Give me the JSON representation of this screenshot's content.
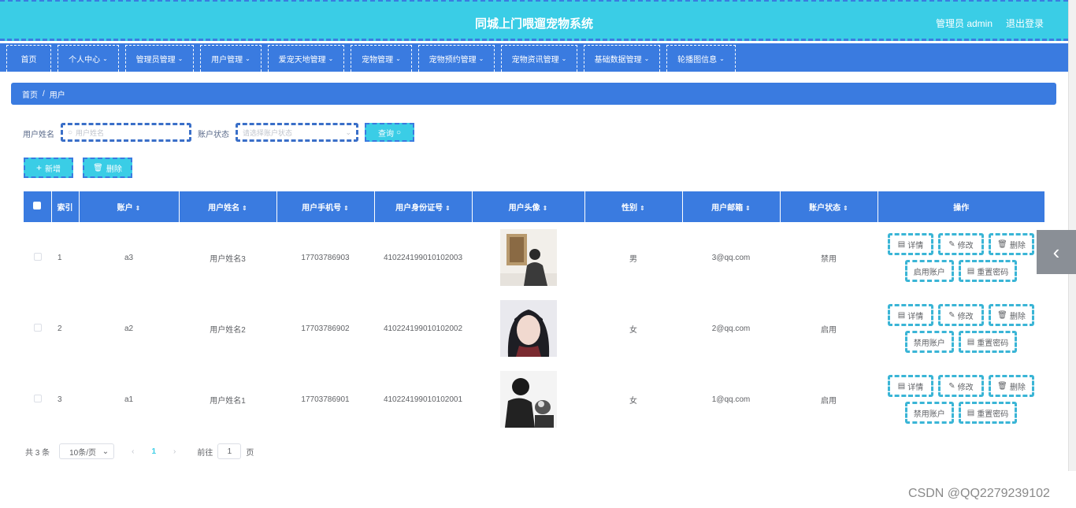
{
  "header": {
    "title": "同城上门喂遛宠物系统",
    "user": "管理员 admin",
    "logout": "退出登录"
  },
  "nav": [
    {
      "label": "首页",
      "dropdown": false
    },
    {
      "label": "个人中心",
      "dropdown": true
    },
    {
      "label": "管理员管理",
      "dropdown": true
    },
    {
      "label": "用户管理",
      "dropdown": true
    },
    {
      "label": "爱宠天地管理",
      "dropdown": true
    },
    {
      "label": "宠物管理",
      "dropdown": true
    },
    {
      "label": "宠物预约管理",
      "dropdown": true
    },
    {
      "label": "宠物资讯管理",
      "dropdown": true
    },
    {
      "label": "基础数据管理",
      "dropdown": true
    },
    {
      "label": "轮播图信息",
      "dropdown": true
    }
  ],
  "breadcrumb": {
    "home": "首页",
    "sep": "/",
    "current": "用户"
  },
  "search": {
    "name_label": "用户姓名",
    "name_placeholder": "用户姓名",
    "status_label": "账户状态",
    "status_placeholder": "请选择账户状态",
    "query": "查询"
  },
  "actions": {
    "add": "新增",
    "delete": "删除"
  },
  "table": {
    "columns": [
      "索引",
      "账户",
      "用户姓名",
      "用户手机号",
      "用户身份证号",
      "用户头像",
      "性别",
      "用户邮箱",
      "账户状态",
      "操作"
    ],
    "rows": [
      {
        "index": "1",
        "account": "a3",
        "name": "用户姓名3",
        "phone": "17703786903",
        "idcard": "410224199010102003",
        "gender": "男",
        "email": "3@qq.com",
        "status": "禁用",
        "toggle": "启用账户"
      },
      {
        "index": "2",
        "account": "a2",
        "name": "用户姓名2",
        "phone": "17703786902",
        "idcard": "410224199010102002",
        "gender": "女",
        "email": "2@qq.com",
        "status": "启用",
        "toggle": "禁用账户"
      },
      {
        "index": "3",
        "account": "a1",
        "name": "用户姓名1",
        "phone": "17703786901",
        "idcard": "410224199010102001",
        "gender": "女",
        "email": "1@qq.com",
        "status": "启用",
        "toggle": "禁用账户"
      }
    ],
    "ops": {
      "detail": "详情",
      "edit": "修改",
      "delete": "删除",
      "reset": "重置密码"
    }
  },
  "pager": {
    "total": "共 3 条",
    "size": "10条/页",
    "current": "1",
    "goto": "前往",
    "goto_value": "1",
    "unit": "页"
  },
  "watermark": "CSDN @QQ2279239102",
  "colors": {
    "header": "#3acde6",
    "primary": "#3a7be0"
  },
  "icons": {
    "side_toggle": "chevron-left-icon"
  }
}
